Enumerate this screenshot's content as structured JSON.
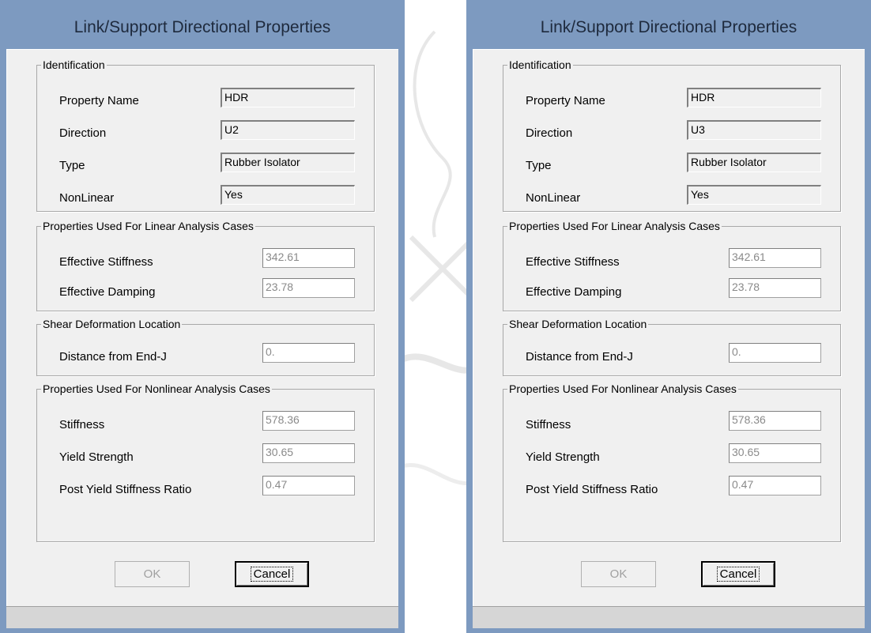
{
  "dialogs": [
    {
      "title": "Link/Support Directional Properties",
      "identification": {
        "legend": "Identification",
        "property_name_label": "Property Name",
        "property_name_value": "HDR",
        "direction_label": "Direction",
        "direction_value": "U2",
        "type_label": "Type",
        "type_value": "Rubber Isolator",
        "nonlinear_label": "NonLinear",
        "nonlinear_value": "Yes"
      },
      "linear": {
        "legend": "Properties Used For Linear Analysis Cases",
        "stiffness_label": "Effective Stiffness",
        "stiffness_value": "342.61",
        "damping_label": "Effective Damping",
        "damping_value": "23.78"
      },
      "shear": {
        "legend": "Shear Deformation Location",
        "distance_label": "Distance from End-J",
        "distance_value": "0."
      },
      "nonlinear": {
        "legend": "Properties Used For Nonlinear Analysis Cases",
        "stiffness_label": "Stiffness",
        "stiffness_value": "578.36",
        "yield_label": "Yield Strength",
        "yield_value": "30.65",
        "ratio_label": "Post Yield Stiffness Ratio",
        "ratio_value": "0.47"
      },
      "buttons": {
        "ok": "OK",
        "cancel": "Cancel"
      }
    },
    {
      "title": "Link/Support Directional Properties",
      "identification": {
        "legend": "Identification",
        "property_name_label": "Property Name",
        "property_name_value": "HDR",
        "direction_label": "Direction",
        "direction_value": "U3",
        "type_label": "Type",
        "type_value": "Rubber Isolator",
        "nonlinear_label": "NonLinear",
        "nonlinear_value": "Yes"
      },
      "linear": {
        "legend": "Properties Used For Linear Analysis Cases",
        "stiffness_label": "Effective Stiffness",
        "stiffness_value": "342.61",
        "damping_label": "Effective Damping",
        "damping_value": "23.78"
      },
      "shear": {
        "legend": "Shear Deformation Location",
        "distance_label": "Distance from End-J",
        "distance_value": "0."
      },
      "nonlinear": {
        "legend": "Properties Used For Nonlinear Analysis Cases",
        "stiffness_label": "Stiffness",
        "stiffness_value": "578.36",
        "yield_label": "Yield Strength",
        "yield_value": "30.65",
        "ratio_label": "Post Yield Stiffness Ratio",
        "ratio_value": "0.47"
      },
      "buttons": {
        "ok": "OK",
        "cancel": "Cancel"
      }
    }
  ],
  "colors": {
    "title_bar": "#7d9ac0",
    "dialog_body": "#f0f0f0",
    "disabled_text": "#a0a0a0"
  }
}
